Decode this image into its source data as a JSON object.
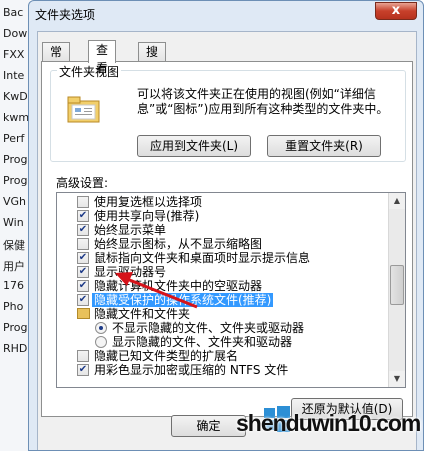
{
  "background_window": {
    "items": [
      "Bac",
      "Dow",
      "FXX",
      "Inte",
      "KwD",
      "kwm",
      "Perf",
      "Prog",
      "Prog",
      "VGh",
      "Win",
      "保健",
      "用户",
      "176",
      "Pho",
      "Prog",
      "RHD"
    ]
  },
  "dialog": {
    "title": "文件夹选项",
    "close_label": "x",
    "tabs": [
      {
        "label": "常规",
        "active": false
      },
      {
        "label": "查看",
        "active": true
      },
      {
        "label": "搜索",
        "active": false
      }
    ],
    "folder_views": {
      "group_label": "文件夹视图",
      "description": "可以将该文件夹正在使用的视图(例如“详细信息”或“图标”)应用到所有这种类型的文件夹中。",
      "apply_button": "应用到文件夹(L)",
      "reset_button": "重置文件夹(R)"
    },
    "advanced": {
      "label": "高级设置:",
      "rows": [
        {
          "type": "checkbox",
          "checked": false,
          "text": "使用复选框以选择项"
        },
        {
          "type": "checkbox",
          "checked": true,
          "text": "使用共享向导(推荐)"
        },
        {
          "type": "checkbox",
          "checked": true,
          "text": "始终显示菜单"
        },
        {
          "type": "checkbox",
          "checked": false,
          "text": "始终显示图标，从不显示缩略图"
        },
        {
          "type": "checkbox",
          "checked": true,
          "text": "鼠标指向文件夹和桌面项时显示提示信息"
        },
        {
          "type": "checkbox",
          "checked": true,
          "text": "显示驱动器号"
        },
        {
          "type": "checkbox",
          "checked": true,
          "text": "隐藏计算机文件夹中的空驱动器"
        },
        {
          "type": "checkbox",
          "checked": true,
          "text": "隐藏受保护的操作系统文件(推荐)",
          "selected": true
        },
        {
          "type": "folder",
          "text": "隐藏文件和文件夹"
        },
        {
          "type": "radio",
          "checked": true,
          "text": "不显示隐藏的文件、文件夹或驱动器"
        },
        {
          "type": "radio",
          "checked": false,
          "text": "显示隐藏的文件、文件夹和驱动器"
        },
        {
          "type": "checkbox",
          "checked": false,
          "text": "隐藏已知文件类型的扩展名"
        },
        {
          "type": "checkbox",
          "checked": true,
          "text": "用彩色显示加密或压缩的 NTFS 文件"
        }
      ]
    },
    "restore_button": "还原为默认值(D)",
    "ok_button": "确定"
  },
  "watermark": {
    "text": "shenduwin10.com"
  },
  "colors": {
    "selection": "#3399ff",
    "annotation_arrow": "#d6131a"
  }
}
